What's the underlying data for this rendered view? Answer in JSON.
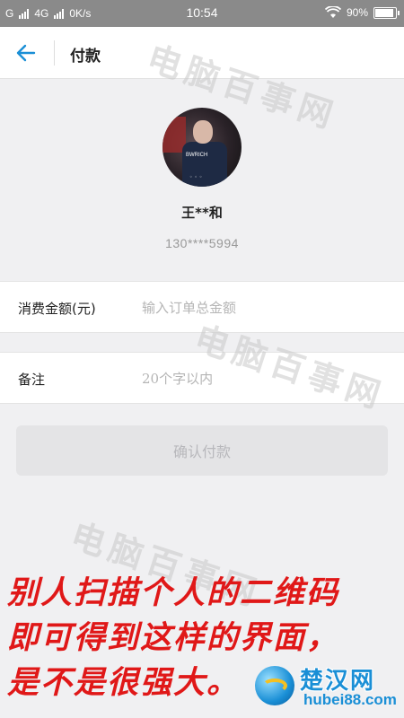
{
  "status_bar": {
    "carrier_left": "G",
    "network": "4G",
    "speed": "0K/s",
    "time": "10:54",
    "battery": "90%",
    "battery_level": 0.9
  },
  "header": {
    "title": "付款"
  },
  "payee": {
    "name": "王**和",
    "phone": "130****5994"
  },
  "form": {
    "amount_label": "消费金额(元)",
    "amount_placeholder": "输入订单总金额",
    "note_label": "备注",
    "note_placeholder": "20个字以内"
  },
  "confirm_label": "确认付款",
  "watermark": "电脑百事网",
  "caption": {
    "line1": "别人扫描个人的二维码",
    "line2": "即可得到这样的界面，",
    "line3": "是不是很强大。"
  },
  "logo": {
    "cn": "楚汉网",
    "en": "hubei88.com"
  },
  "colors": {
    "accent": "#1a8fd6",
    "caption": "#e01818",
    "status_bar": "#8a8a8a"
  }
}
